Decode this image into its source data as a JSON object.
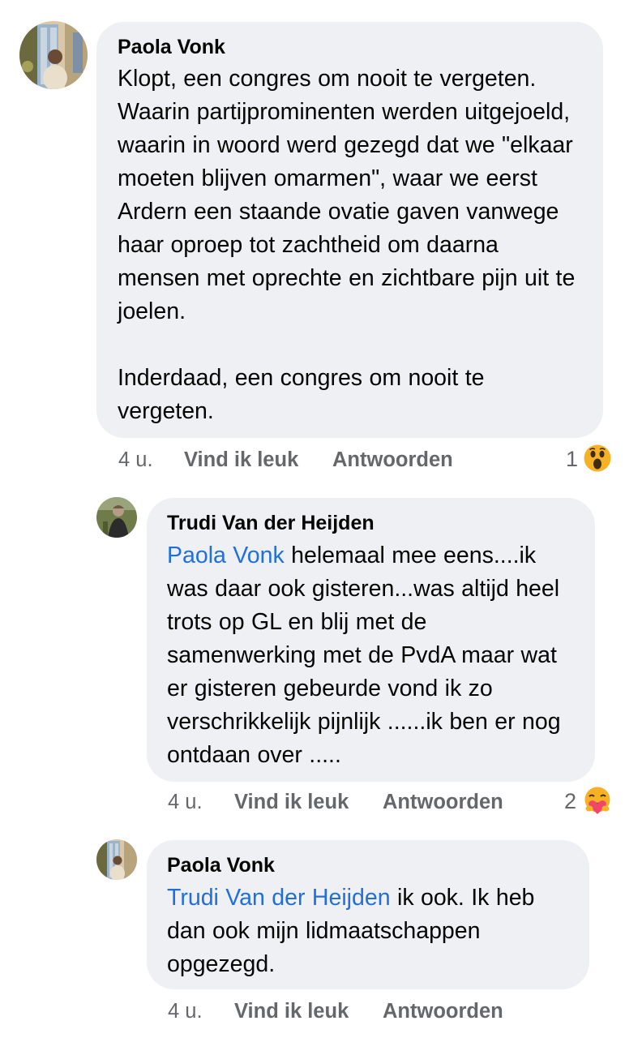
{
  "comments": [
    {
      "author": "Paola Vonk",
      "text": "Klopt, een congres om nooit te vergeten. Waarin partijprominenten werden uitgejoeld, waarin in woord werd gezegd dat we \"elkaar moeten blijven omarmen\", waar we eerst Ardern een staande ovatie gaven vanwege haar oproep tot zachtheid om daarna mensen met oprechte en zichtbare pijn uit te joelen.",
      "text2": "Inderdaad, een congres om nooit te vergeten.",
      "time": "4 u.",
      "like": "Vind ik leuk",
      "reply": "Antwoorden",
      "reaction_count": "1",
      "reaction_icon": "wow-emoji-icon"
    },
    {
      "author": "Trudi Van der Heijden",
      "mention": "Paola Vonk",
      "text": " helemaal mee eens....ik was daar ook gisteren...was altijd heel trots op GL en blij met de samenwerking met de PvdA maar wat er gisteren gebeurde vond ik zo verschrikkelijk pijnlijk ......ik ben er nog ontdaan over .....",
      "time": "4 u.",
      "like": "Vind ik leuk",
      "reply": "Antwoorden",
      "reaction_count": "2",
      "reaction_icon": "care-emoji-icon"
    },
    {
      "author": "Paola Vonk",
      "mention": "Trudi Van der Heijden",
      "text": " ik ook. Ik heb dan ook mijn lidmaatschappen opgezegd.",
      "time": "4 u.",
      "like": "Vind ik leuk",
      "reply": "Antwoorden"
    }
  ],
  "colors": {
    "bubble": "#eff0f3",
    "mention": "#216fdb",
    "meta": "#65676b"
  }
}
